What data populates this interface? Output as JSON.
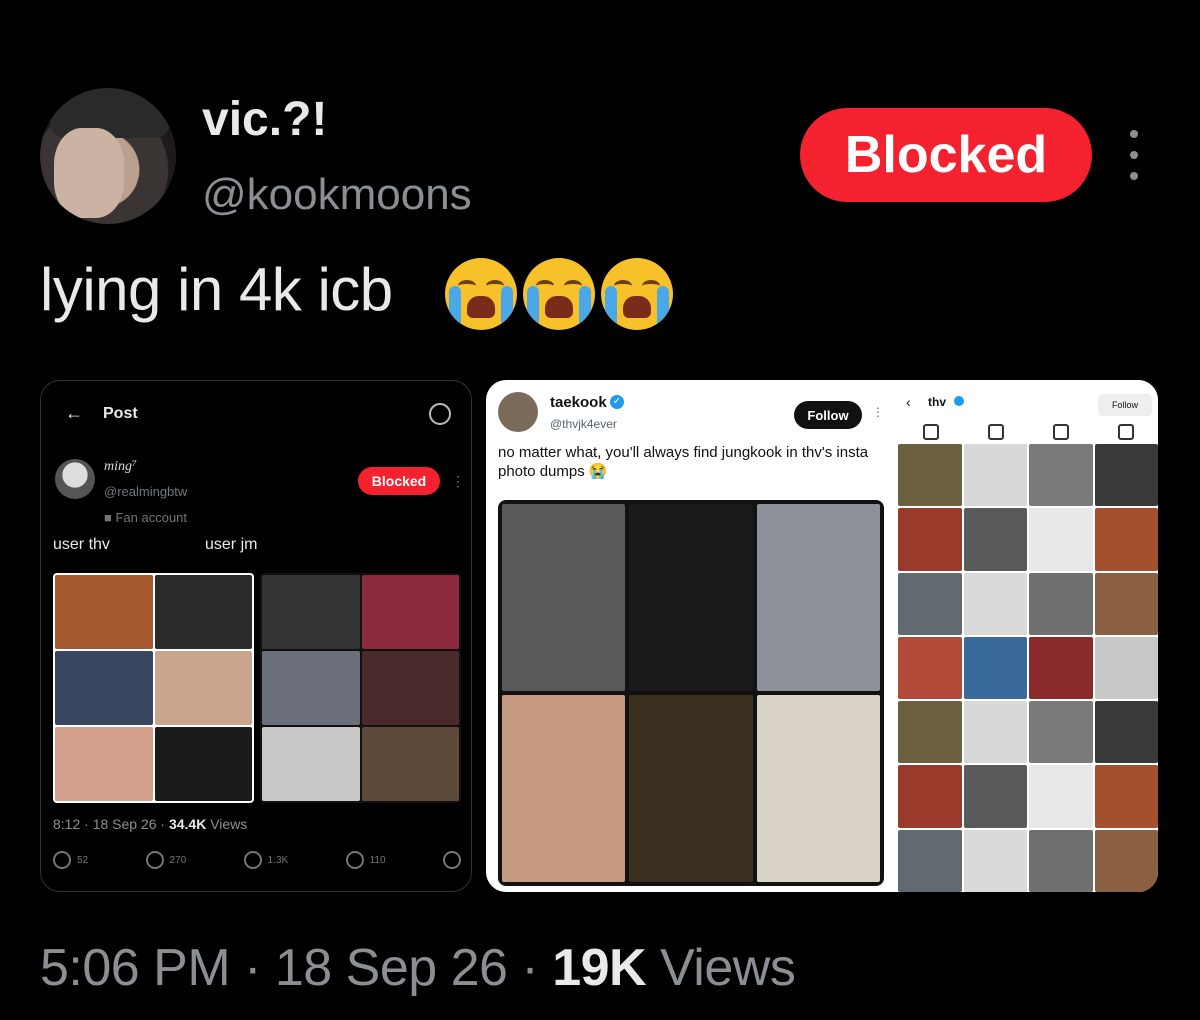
{
  "tweet": {
    "author_name": "vic.?!",
    "author_handle": "@kookmoons",
    "block_label": "Blocked",
    "text": "lying in 4k icb",
    "emoji": "loudly-crying-face",
    "time": "5:06 PM",
    "date": "18 Sep 26",
    "views_count": "19K",
    "views_label": "Views"
  },
  "quoted_left": {
    "header_title": "Post",
    "user_name": "ming⁷",
    "user_handle": "@realmingbtw",
    "badge": "Fan account",
    "block_label": "Blocked",
    "text_left": "user thv",
    "text_right": "user jm",
    "meta_time_date": "8:12 · 18 Sep 26 · ",
    "meta_views_count": "34.4K",
    "meta_views_label": "Views",
    "actions": [
      {
        "icon": "reply-icon",
        "count": "52"
      },
      {
        "icon": "retweet-icon",
        "count": "270"
      },
      {
        "icon": "like-icon",
        "count": "1.3K"
      },
      {
        "icon": "bookmark-icon",
        "count": "110"
      }
    ]
  },
  "quoted_right": {
    "user_name": "taekook",
    "user_handle": "@thvjk4ever",
    "follow_label": "Follow",
    "text": "no matter what, you'll always find jungkook in thv's insta photo dumps 😭",
    "ig_profile_name": "thv",
    "ig_follow_label": "Follow"
  },
  "colors": {
    "block_red": "#f4212e",
    "verified_blue": "#1d9bf0",
    "muted_gray": "#8b8f94"
  }
}
